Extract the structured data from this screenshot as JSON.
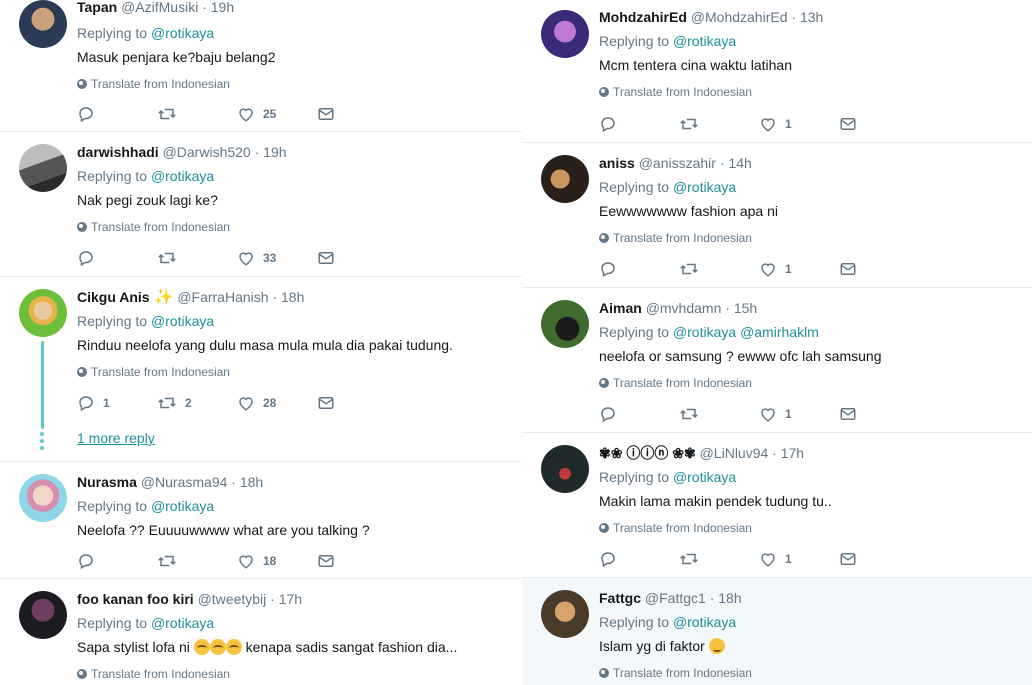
{
  "common": {
    "replying_prefix": "Replying to",
    "translate_label": "Translate from Indonesian",
    "dot": "·"
  },
  "left": [
    {
      "name": "Tapan",
      "handle": "@AzifMusiki",
      "time": "19h",
      "mentions": [
        "@rotikaya"
      ],
      "text": "Masuk penjara ke?baju belang2",
      "reply_count": "",
      "retweet_count": "",
      "like_count": "25",
      "avatar_colors": [
        "#2b3a55",
        "#c9a27b"
      ]
    },
    {
      "name": "darwishhadi",
      "handle": "@Darwish520",
      "time": "19h",
      "mentions": [
        "@rotikaya"
      ],
      "text": "Nak pegi zouk lagi ke?",
      "reply_count": "",
      "retweet_count": "",
      "like_count": "33",
      "avatar_colors": [
        "#6e6e6e",
        "#bdbdbd"
      ]
    },
    {
      "name": "Cikgu Anis",
      "handle": "@FarraHanish",
      "time": "18h",
      "mentions": [
        "@rotikaya"
      ],
      "text": "Rinduu neelofa yang dulu masa mula mula dia pakai tudung.",
      "reply_count": "1",
      "retweet_count": "2",
      "like_count": "28",
      "more_reply": "1 more reply",
      "avatar_colors": [
        "#6dbf3b",
        "#e8b24a"
      ]
    },
    {
      "name": "Nurasma",
      "handle": "@Nurasma94",
      "time": "18h",
      "mentions": [
        "@rotikaya"
      ],
      "text": "Neelofa ?? Euuuuwwww what are you talking ?",
      "reply_count": "",
      "retweet_count": "",
      "like_count": "18",
      "avatar_colors": [
        "#8ed6e8",
        "#d68fb0"
      ]
    },
    {
      "name": "foo kanan foo kiri",
      "handle": "@tweetybij",
      "time": "17h",
      "mentions": [
        "@rotikaya"
      ],
      "text_before": "Sapa stylist lofa ni",
      "text_after": "kenapa sadis sangat fashion dia...",
      "avatar_colors": [
        "#1d1b22",
        "#6b3f5d"
      ]
    }
  ],
  "right": [
    {
      "name": "MohdzahirEd",
      "handle": "@MohdzahirEd",
      "time": "13h",
      "mentions": [
        "@rotikaya"
      ],
      "text": "Mcm tentera cina waktu latihan",
      "reply_count": "",
      "retweet_count": "",
      "like_count": "1",
      "avatar_colors": [
        "#3b2a7a",
        "#c07ad6"
      ]
    },
    {
      "name": "aniss",
      "handle": "@anisszahir",
      "time": "14h",
      "mentions": [
        "@rotikaya"
      ],
      "text": "Eewwwwwww fashion apa ni",
      "reply_count": "",
      "retweet_count": "",
      "like_count": "1",
      "avatar_colors": [
        "#2b1f1a",
        "#c9955f"
      ]
    },
    {
      "name": "Aiman",
      "handle": "@mvhdamn",
      "time": "15h",
      "mentions": [
        "@rotikaya",
        "@amirhaklm"
      ],
      "text": "neelofa or samsung ? ewww ofc lah samsung",
      "reply_count": "",
      "retweet_count": "",
      "like_count": "1",
      "avatar_colors": [
        "#3f6b2f",
        "#1b1b1b"
      ]
    },
    {
      "name": "✾❀ ⓘⓘⓝ ❀✾",
      "handle": "@LiNluv94",
      "time": "17h",
      "mentions": [
        "@rotikaya"
      ],
      "text": "Makin lama makin pendek tudung tu..",
      "reply_count": "",
      "retweet_count": "",
      "like_count": "1",
      "avatar_colors": [
        "#1e2b2a",
        "#c23a3a"
      ]
    },
    {
      "name": "Fattgc",
      "handle": "@Fattgc1",
      "time": "18h",
      "mentions": [
        "@rotikaya"
      ],
      "text": "Islam yg di faktor",
      "avatar_colors": [
        "#4a3a2a",
        "#d6a36a"
      ]
    }
  ]
}
